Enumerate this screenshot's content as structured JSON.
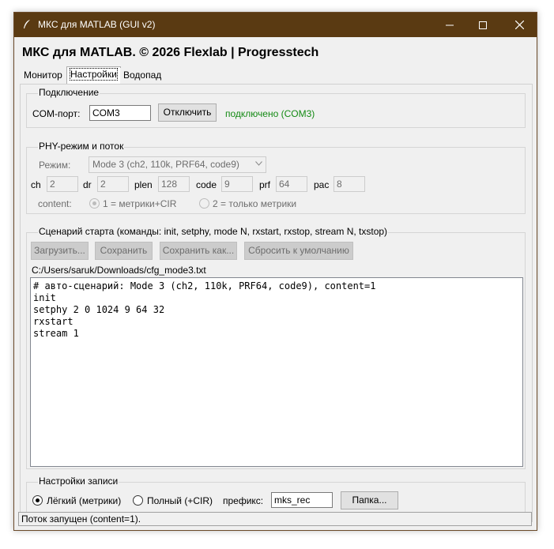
{
  "window": {
    "title": "МКС для MATLAB  (GUI v2)",
    "heading": "МКС для MATLAB. © 2026 Flexlab | Progresstech"
  },
  "tabs": [
    {
      "label": "Монитор",
      "active": false
    },
    {
      "label": "Настройки",
      "active": true
    },
    {
      "label": "Водопад",
      "active": false
    }
  ],
  "connection": {
    "group_title": "Подключение",
    "port_label": "COM-порт:",
    "port_value": "COM3",
    "disconnect_button": "Отключить",
    "status": "подключено (COM3)",
    "status_color": "#138a13"
  },
  "phy": {
    "group_title": "PHY-режим и поток",
    "mode_label": "Режим:",
    "mode_value": "Mode 3 (ch2, 110k, PRF64, code9)",
    "params": [
      {
        "label": "ch",
        "value": "2"
      },
      {
        "label": "dr",
        "value": "2"
      },
      {
        "label": "plen",
        "value": "128"
      },
      {
        "label": "code",
        "value": "9"
      },
      {
        "label": "prf",
        "value": "64"
      },
      {
        "label": "pac",
        "value": "8"
      }
    ],
    "content_label": "content:",
    "content_option1": "1 = метрики+CIR",
    "content_option2": "2 = только метрики",
    "content_selected": 1
  },
  "scenario": {
    "group_title": "Сценарий старта (команды: init, setphy, mode N, rxstart, rxstop, stream N, txstop)",
    "load_button": "Загрузить...",
    "save_button": "Сохранить",
    "save_as_button": "Сохранить как...",
    "reset_button": "Сбросить к умолчанию",
    "file_path": "C:/Users/saruk/Downloads/cfg_mode3.txt",
    "lines": [
      "# авто-сценарий: Mode 3 (ch2, 110k, PRF64, code9), content=1",
      "init",
      "setphy 2 0 1024 9 64 32",
      "rxstart",
      "stream 1"
    ]
  },
  "recording": {
    "group_title": "Настройки записи",
    "option_light": "Лёгкий (метрики)",
    "option_full": "Полный (+CIR)",
    "selected": "light",
    "prefix_label": "префикс:",
    "prefix_value": "mks_rec",
    "folder_button": "Папка..."
  },
  "statusbar": {
    "text": "Поток запущен (content=1)."
  },
  "colors": {
    "titlebar": "#5a3a12",
    "window_bg": "#f0f0f0"
  }
}
